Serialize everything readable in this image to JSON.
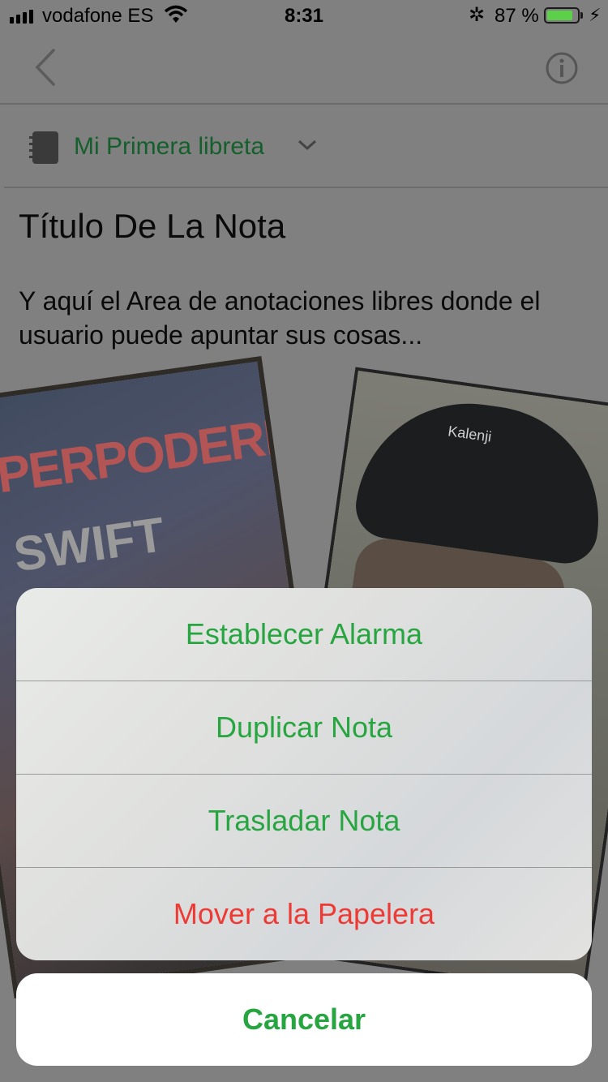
{
  "status_bar": {
    "carrier": "vodafone ES",
    "time": "8:31",
    "battery_percent": "87 %",
    "battery_level": 0.87,
    "icons": [
      "signal-icon",
      "wifi-icon",
      "bluetooth-icon",
      "battery-icon",
      "charging-icon"
    ]
  },
  "nav": {
    "icons": [
      "back-chevron-icon",
      "info-icon"
    ]
  },
  "notebook": {
    "name": "Mi Primera libreta",
    "icon": "notebook-icon",
    "chevron": "chevron-down-icon"
  },
  "note": {
    "title": "Título De La Nota",
    "body": "Y aquí el Area de anotaciones libres donde el usuario puede apuntar sus cosas..."
  },
  "photos": {
    "photo1_text_line1": "UPERPODERES",
    "photo1_text_line2": "SWIFT",
    "photo2_cap_text": "Kalenji"
  },
  "action_sheet": {
    "items": [
      {
        "label": "Establecer Alarma",
        "style": "default"
      },
      {
        "label": "Duplicar Nota",
        "style": "default"
      },
      {
        "label": "Trasladar Nota",
        "style": "default"
      },
      {
        "label": "Mover a la Papelera",
        "style": "destructive"
      }
    ],
    "cancel_label": "Cancelar"
  },
  "colors": {
    "accent_green": "#26a540",
    "destructive_red": "#ee3a35",
    "battery_green": "#5dd04a"
  }
}
